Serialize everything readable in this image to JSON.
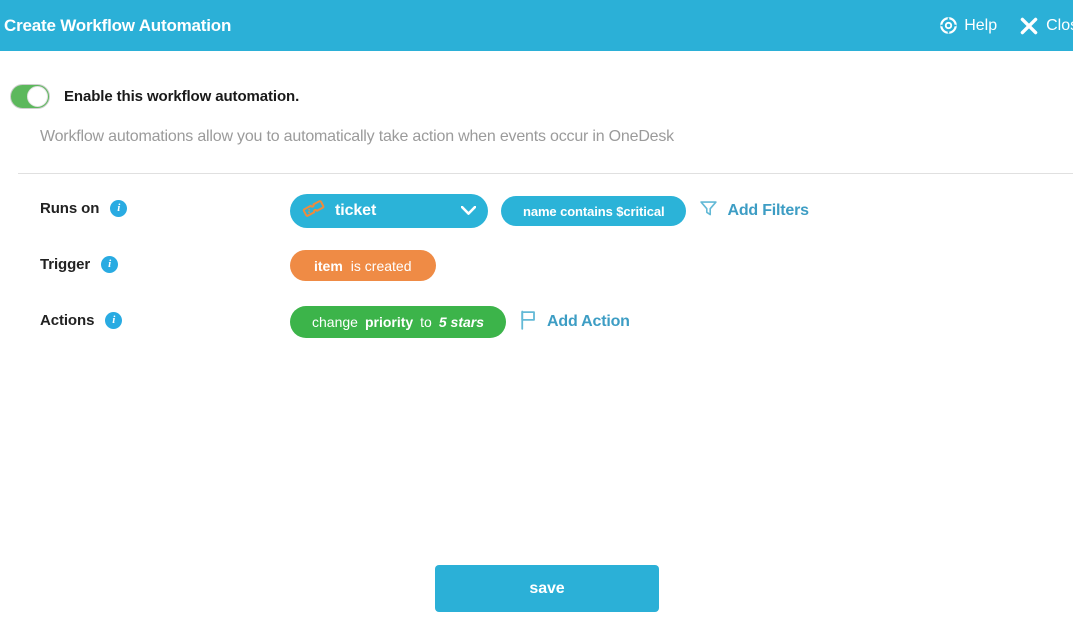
{
  "window": {
    "title": "Create Workflow Automation",
    "help_label": "Help",
    "close_label": "Close",
    "help_icon": "lifebuoy-icon",
    "close_icon": "close-x-icon",
    "header_color": "#2bb0d7"
  },
  "enable": {
    "label": "Enable this workflow automation.",
    "state": "on",
    "toggle_color": "#5cb85c"
  },
  "description": "Workflow automations allow you to automatically take action when events occur in OneDesk",
  "rows": {
    "runs_on": {
      "label": "Runs on",
      "info_icon": "info-icon",
      "type_pill": {
        "icon": "ticket-icon",
        "label": "ticket",
        "color": "#2bb3d8",
        "chevron": "chevron-down-icon"
      },
      "filter_pill": {
        "label": "name contains $critical",
        "color": "#2bb3d8"
      },
      "add_filters": {
        "icon": "filter-funnel-icon",
        "label": "Add Filters",
        "color": "#3d9dc4"
      }
    },
    "trigger": {
      "label": "Trigger",
      "info_icon": "info-icon",
      "pill": {
        "subject": "item",
        "event": "is created",
        "color": "#ef8b45"
      }
    },
    "actions": {
      "label": "Actions",
      "info_icon": "info-icon",
      "pill": {
        "verb": "change",
        "field": "priority",
        "connector": "to",
        "value": "5 stars",
        "color": "#3cb44a"
      },
      "add_action": {
        "icon": "flag-icon",
        "label": "Add Action",
        "color": "#3d9dc4"
      }
    }
  },
  "footer": {
    "save_label": "save",
    "save_color": "#2bb0d7"
  }
}
